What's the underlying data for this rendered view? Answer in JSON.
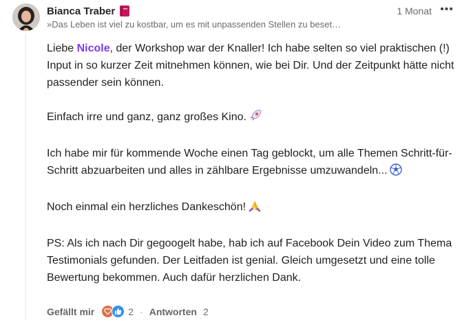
{
  "comment": {
    "author": "Bianca Traber",
    "headline": "»Das Leben ist viel zu kostbar, um es mit unpassenden Stellen zu beset…",
    "time": "1 Monat",
    "more": "•••",
    "body": {
      "p1_pre": "Liebe ",
      "mention": "Nicole",
      "p1_post": ", der Workshop war der Knaller! Ich habe selten so viel praktischen (!) Input in so kurzer Zeit mitnehmen können, wie bei Dir. Und der Zeitpunkt hätte nicht passender sein können.",
      "p2": "Einfach irre und ganz, ganz großes Kino.",
      "p3": "Ich habe mir für kommende Woche einen Tag geblockt, um alle Themen Schritt-für-Schritt abzuarbeiten und alles in zählbare Ergebnisse umzuwandeln...",
      "p4": "Noch einmal ein herzliches Dankeschön!",
      "p5": "PS: Als ich nach Dir gegoogelt habe, hab ich auf Facebook Dein Video zum Thema Testimonials gefunden. Der Leitfaden ist genial. Gleich umgesetzt und eine tolle Bewertung bekommen. Auch dafür herzlichen Dank."
    },
    "actions": {
      "like_label": "Gefällt mir",
      "reaction_count": "2",
      "separator": "·",
      "reply_label": "Antworten",
      "reply_count": "2"
    }
  },
  "icons": {
    "title_emoji": "book-icon",
    "p2_emoji": "rocket-icon",
    "p3_emoji": "soccer-ball-icon",
    "p4_emoji": "folded-hands-icon",
    "reactions": [
      "heart-reaction-icon",
      "like-reaction-icon"
    ]
  },
  "colors": {
    "mention": "#7c3aed",
    "heart_reaction": "#df704d",
    "like_reaction": "#378fe9"
  }
}
